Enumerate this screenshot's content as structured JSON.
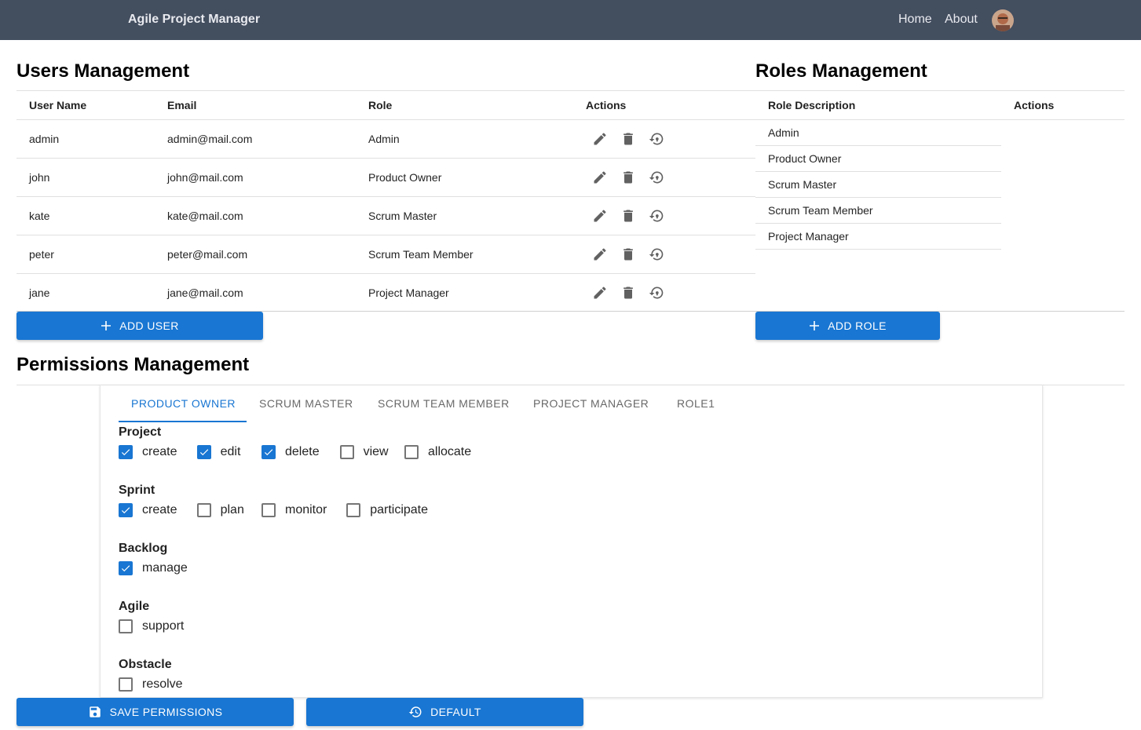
{
  "navbar": {
    "brand": "Agile Project Manager",
    "home": "Home",
    "about": "About"
  },
  "users": {
    "title": "Users Management",
    "headers": {
      "name": "User Name",
      "email": "Email",
      "role": "Role",
      "actions": "Actions"
    },
    "rows": [
      {
        "name": "admin",
        "email": "admin@mail.com",
        "role": "Admin"
      },
      {
        "name": "john",
        "email": "john@mail.com",
        "role": "Product Owner"
      },
      {
        "name": "kate",
        "email": "kate@mail.com",
        "role": "Scrum Master"
      },
      {
        "name": "peter",
        "email": "peter@mail.com",
        "role": "Scrum Team Member"
      },
      {
        "name": "jane",
        "email": "jane@mail.com",
        "role": "Project Manager"
      }
    ],
    "add_label": "ADD USER"
  },
  "roles": {
    "title": "Roles Management",
    "headers": {
      "description": "Role Description",
      "actions": "Actions"
    },
    "rows": [
      "Admin",
      "Product Owner",
      "Scrum Master",
      "Scrum Team Member",
      "Project Manager"
    ],
    "add_label": "ADD ROLE"
  },
  "permissions": {
    "title": "Permissions Management",
    "tabs": [
      "PRODUCT OWNER",
      "SCRUM MASTER",
      "SCRUM TEAM MEMBER",
      "PROJECT MANAGER",
      "ROLE1"
    ],
    "active_tab": 0,
    "groups": [
      {
        "name": "Project",
        "items": [
          {
            "label": "create",
            "checked": true
          },
          {
            "label": "edit",
            "checked": true
          },
          {
            "label": "delete",
            "checked": true
          },
          {
            "label": "view",
            "checked": false
          },
          {
            "label": "allocate",
            "checked": false
          }
        ]
      },
      {
        "name": "Sprint",
        "items": [
          {
            "label": "create",
            "checked": true
          },
          {
            "label": "plan",
            "checked": false
          },
          {
            "label": "monitor",
            "checked": false
          },
          {
            "label": "participate",
            "checked": false
          }
        ]
      },
      {
        "name": "Backlog",
        "items": [
          {
            "label": "manage",
            "checked": true
          }
        ]
      },
      {
        "name": "Agile",
        "items": [
          {
            "label": "support",
            "checked": false
          }
        ]
      },
      {
        "name": "Obstacle",
        "items": [
          {
            "label": "resolve",
            "checked": false
          }
        ]
      }
    ],
    "save_label": "SAVE PERMISSIONS",
    "default_label": "DEFAULT"
  },
  "colors": {
    "navbar": "#434e5f",
    "primary": "#1976d2"
  },
  "icons": {
    "edit": "pencil-icon",
    "delete": "trash-icon",
    "reset": "reset-password-icon",
    "add": "plus-icon",
    "save": "floppy-disk-icon",
    "default": "history-icon"
  }
}
